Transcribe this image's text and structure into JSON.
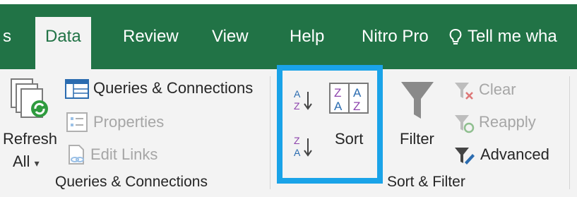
{
  "tabs": [
    {
      "label": "s",
      "active": false
    },
    {
      "label": "Data",
      "active": true
    },
    {
      "label": "Review",
      "active": false
    },
    {
      "label": "View",
      "active": false
    },
    {
      "label": "Help",
      "active": false
    },
    {
      "label": "Nitro Pro",
      "active": false
    }
  ],
  "tell_me": {
    "label": "Tell me wha",
    "icon": "lightbulb-icon"
  },
  "groups": {
    "queries": {
      "label": "Queries & Connections",
      "refresh": {
        "label_top": "Refresh",
        "label_bottom": "All",
        "icon": "refresh-icon"
      },
      "items": [
        {
          "label": "Queries & Connections",
          "icon": "queries-icon",
          "enabled": true
        },
        {
          "label": "Properties",
          "icon": "properties-icon",
          "enabled": false
        },
        {
          "label": "Edit Links",
          "icon": "edit-links-icon",
          "enabled": false
        }
      ]
    },
    "sort_filter": {
      "label": "Sort & Filter",
      "sort_az": {
        "icon": "sort-a-to-z-icon"
      },
      "sort_za": {
        "icon": "sort-z-to-a-icon"
      },
      "sort": {
        "label": "Sort",
        "icon": "sort-dialog-icon"
      },
      "filter": {
        "label": "Filter",
        "icon": "funnel-icon"
      },
      "clear": {
        "label": "Clear",
        "enabled": false,
        "icon": "clear-filter-icon"
      },
      "reapply": {
        "label": "Reapply",
        "enabled": false,
        "icon": "reapply-icon"
      },
      "advanced": {
        "label": "Advanced",
        "enabled": true,
        "icon": "advanced-filter-icon"
      }
    }
  },
  "colors": {
    "ribbon": "#217346",
    "highlight": "#1aa3e8",
    "disabled": "#a6a6a6"
  }
}
